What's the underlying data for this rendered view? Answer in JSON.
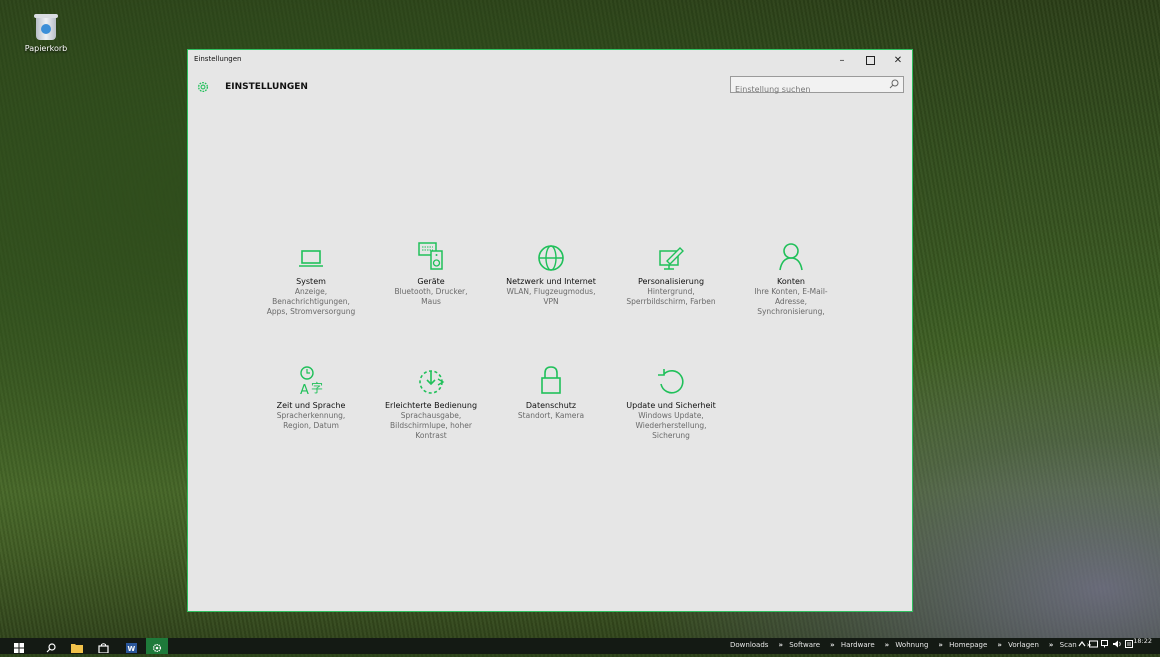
{
  "desktop": {
    "recycle_bin_label": "Papierkorb"
  },
  "window": {
    "title": "Einstellungen",
    "header_title": "EINSTELLUNGEN",
    "search_placeholder": "Einstellung suchen",
    "controls": {
      "minimize": "–",
      "close": "✕"
    },
    "accent_color": "#20c05a"
  },
  "categories": [
    {
      "icon": "laptop-icon",
      "name": "System",
      "desc": [
        "Anzeige,",
        "Benachrichtigungen,",
        "Apps, Stromversorgung"
      ]
    },
    {
      "icon": "devices-icon",
      "name": "Geräte",
      "desc": [
        "Bluetooth, Drucker,",
        "Maus"
      ]
    },
    {
      "icon": "globe-icon",
      "name": "Netzwerk und Internet",
      "desc": [
        "WLAN, Flugzeugmodus,",
        "VPN"
      ]
    },
    {
      "icon": "personalization-icon",
      "name": "Personalisierung",
      "desc": [
        "Hintergrund,",
        "Sperrbildschirm, Farben"
      ]
    },
    {
      "icon": "person-icon",
      "name": "Konten",
      "desc": [
        "Ihre Konten, E-Mail-",
        "Adresse,",
        "Synchronisierung,"
      ]
    },
    {
      "icon": "time-language-icon",
      "name": "Zeit und Sprache",
      "desc": [
        "Spracherkennung,",
        "Region, Datum"
      ]
    },
    {
      "icon": "ease-of-access-icon",
      "name": "Erleichterte Bedienung",
      "desc": [
        "Sprachausgabe,",
        "Bildschirmlupe, hoher",
        "Kontrast"
      ]
    },
    {
      "icon": "lock-icon",
      "name": "Datenschutz",
      "desc": [
        "Standort, Kamera"
      ]
    },
    {
      "icon": "update-icon",
      "name": "Update und Sicherheit",
      "desc": [
        "Windows Update,",
        "Wiederherstellung,",
        "Sicherung"
      ]
    }
  ],
  "taskbar": {
    "links": [
      "Downloads",
      "Software",
      "Hardware",
      "Wohnung",
      "Homepage",
      "Vorlagen",
      "Scan"
    ],
    "link_separator": "»",
    "time": "18:22"
  }
}
